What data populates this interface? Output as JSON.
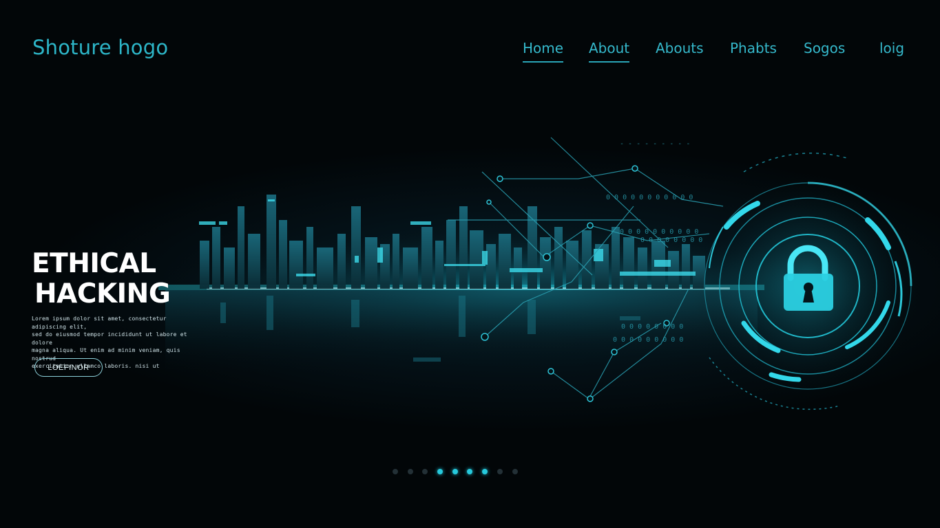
{
  "brand": {
    "logo_text": "Shoture hogo"
  },
  "nav": {
    "items": [
      {
        "id": "home",
        "label": "Home",
        "active": true
      },
      {
        "id": "about",
        "label": "About",
        "active": true
      },
      {
        "id": "abouts",
        "label": "Abouts",
        "active": false
      },
      {
        "id": "phabts",
        "label": "Phabts",
        "active": false
      },
      {
        "id": "sogos",
        "label": "Sogos",
        "active": false
      },
      {
        "id": "loig",
        "label": "loig",
        "active": false
      }
    ]
  },
  "hero": {
    "title_line1": "ETHICAL",
    "title_line2": "HACKING",
    "body_lines": [
      "Lorem ipsum dolor sit amet, consectetur adipiscing elit,",
      "sed do eiusmod tempor incididunt ut labore et dolore",
      "magna aliqua. Ut enim ad minim veniam, quis nostrud",
      "exercitation ullamco laboris. nisi ut"
    ],
    "cta_label": "LOEFINOR"
  },
  "carousel": {
    "total": 9,
    "active_indices": [
      3,
      4,
      5,
      6
    ]
  },
  "colors": {
    "accent": "#2db6c8",
    "glow": "#27d8ea",
    "background": "#020608",
    "title": "#ffffff"
  },
  "icons": [
    "padlock-icon",
    "circuit-network",
    "city-skyline"
  ]
}
